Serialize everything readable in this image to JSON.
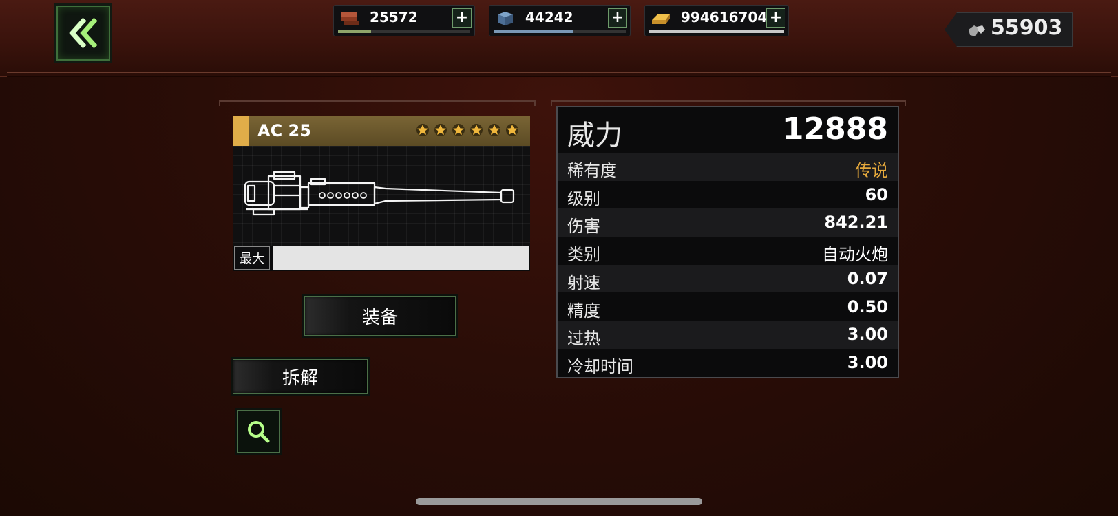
{
  "resources": [
    {
      "name": "bricks",
      "value": "25572",
      "icon": "brick-icon",
      "fill": 0.25,
      "color": "#8fa56a"
    },
    {
      "name": "crates",
      "value": "44242",
      "icon": "crate-icon",
      "fill": 0.6,
      "color": "#7a98b6"
    },
    {
      "name": "gold",
      "value": "994616704",
      "icon": "gold-bar-icon",
      "fill": 1.0,
      "color": "#c8c8c8"
    }
  ],
  "premium": {
    "value": "55903",
    "icon": "gem-icon"
  },
  "weapon": {
    "name": "AC 25",
    "stars": 6,
    "max_label": "最大",
    "rarity_color": "#e0ad49"
  },
  "actions": {
    "equip_label": "装备",
    "disassemble_label": "拆解"
  },
  "stats": {
    "power_label": "威力",
    "power_value": "12888",
    "rows": [
      {
        "label": "稀有度",
        "value": "传说"
      },
      {
        "label": "级别",
        "value": "60"
      },
      {
        "label": "伤害",
        "value": "842.21"
      },
      {
        "label": "类别",
        "value": "自动火炮"
      },
      {
        "label": "射速",
        "value": "0.07"
      },
      {
        "label": "精度",
        "value": "0.50"
      },
      {
        "label": "过热",
        "value": "3.00"
      },
      {
        "label": "冷却时间",
        "value": "3.00"
      }
    ]
  },
  "colors": {
    "accent_green": "#6e9a6a",
    "legend_orange": "#e5a93c"
  }
}
